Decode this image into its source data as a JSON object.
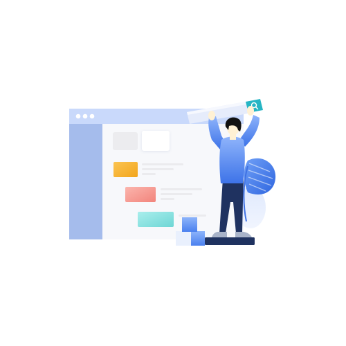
{
  "colors": {
    "titlebar": "#c9d9fb",
    "sidebar": "#a5bcec",
    "content_bg": "#f7f8fb",
    "card_gray": "#ececef",
    "card_white": "#ffffff",
    "tile_orange": "#f7b531",
    "tile_red": "#f59a93",
    "tile_teal": "#8de3e1",
    "text_line": "#ebebee",
    "search_accent": "#26b5c4",
    "shirt": "#4f86f0",
    "pants": "#1f3260",
    "skin": "#fff1d4",
    "hair": "#111111",
    "plant": "#4b84f0",
    "box": "#6e9ff5",
    "pedestal": "#1f3260"
  },
  "icons": {
    "window_dots": "window-dots-icon",
    "search": "search-icon",
    "plant": "leaf-icon"
  }
}
